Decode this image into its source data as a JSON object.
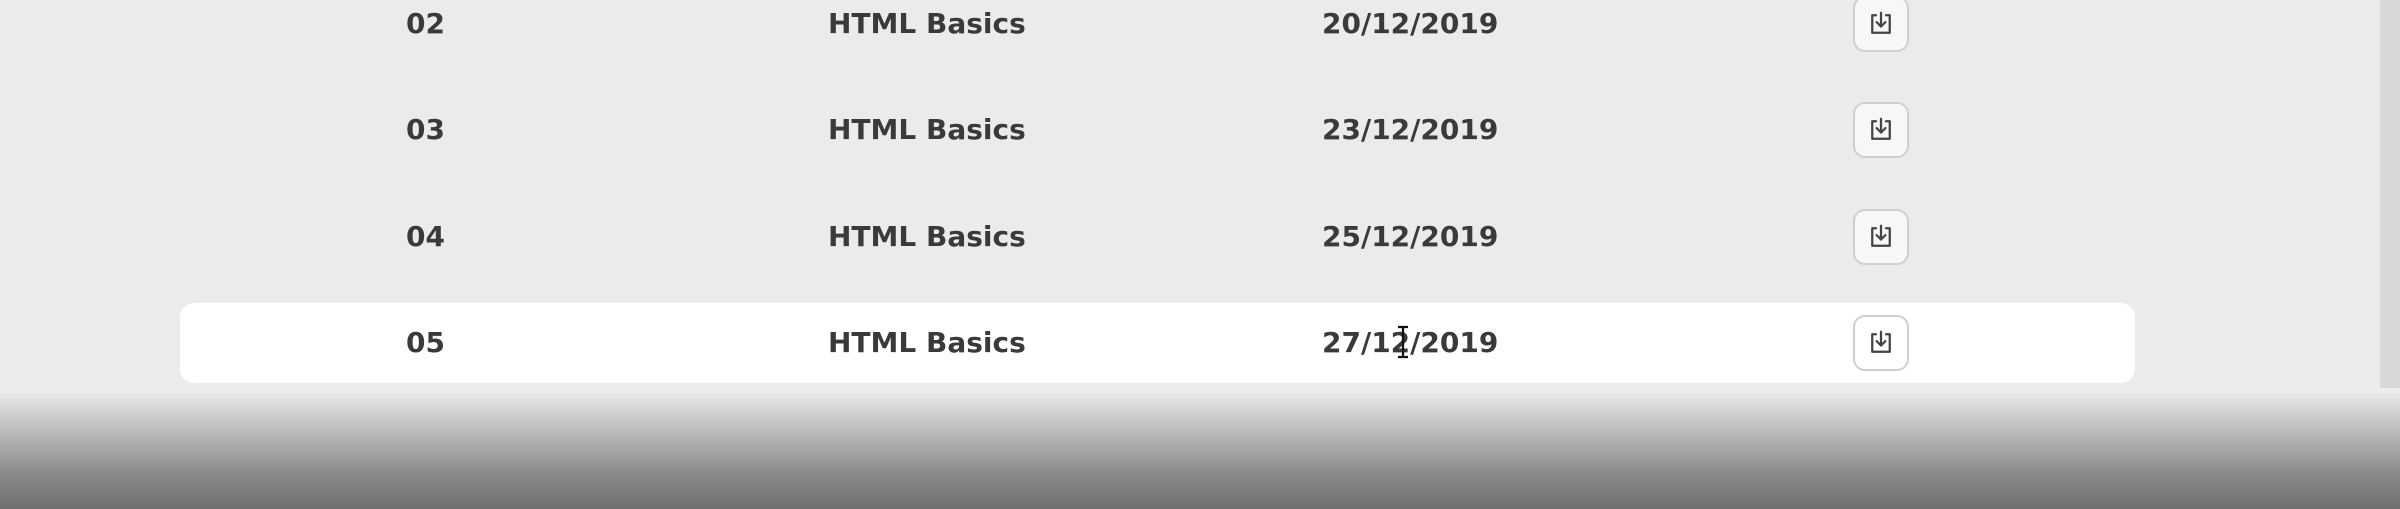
{
  "lessons": [
    {
      "number": "02",
      "course": "HTML Basics",
      "date": "20/12/2019"
    },
    {
      "number": "03",
      "course": "HTML Basics",
      "date": "23/12/2019"
    },
    {
      "number": "04",
      "course": "HTML Basics",
      "date": "25/12/2019"
    },
    {
      "number": "05",
      "course": "HTML Basics",
      "date": "27/12/2019"
    }
  ],
  "icons": {
    "download": "download-icon",
    "cursor": "text-cursor-icon"
  },
  "colors": {
    "page_background": "#ebebeb",
    "highlighted_row": "#ffffff",
    "text": "#3a3a3a",
    "button_border": "#cfcfcf"
  }
}
